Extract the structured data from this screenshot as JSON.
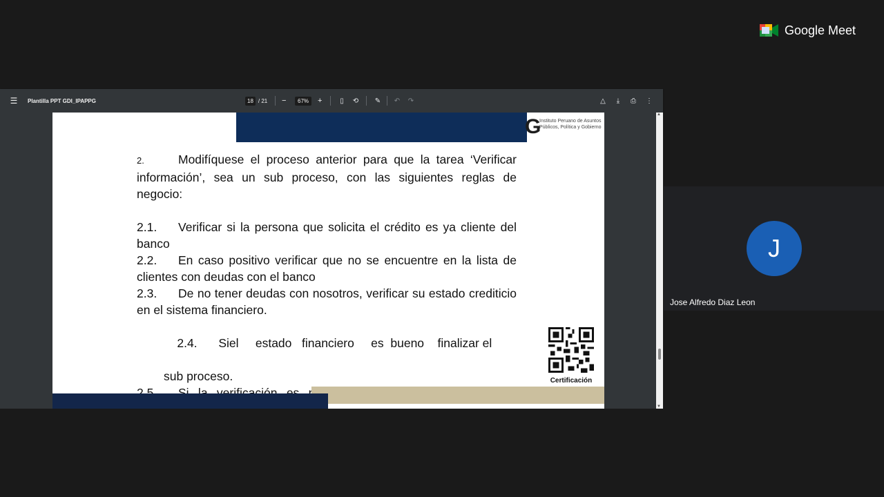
{
  "viewer": {
    "title": "Plantilla PPT GDI_IPAPPG",
    "page_current": "18",
    "page_total": "/ 21",
    "zoom": "67%",
    "icons": [
      "menu-icon",
      "zoom-out-icon",
      "zoom-in-icon",
      "fit-page-icon",
      "rotate-icon",
      "annotate-icon",
      "undo-icon",
      "redo-icon",
      "save-to-drive-icon",
      "download-icon",
      "print-icon",
      "more-icon"
    ]
  },
  "slide": {
    "logo_letter": "G",
    "logo_text": "Instituto Peruano de Asuntos Públicos, Política y Gobierno",
    "intro_num": "2.",
    "intro_text": "Modifíquese el proceso anterior para que la tarea ‘Verificar información’, sea un sub proceso, con las siguientes reglas de negocio:",
    "items": [
      {
        "num": "2.1.",
        "text": "Verificar si la persona que solicita el crédito es ya cliente del banco"
      },
      {
        "num": "2.2.",
        "text": "En caso positivo verificar que no se encuentre en la lista de clientes con deudas con el banco"
      },
      {
        "num": "2.3.",
        "text": "De no tener deudas con nosotros, verificar su estado crediticio en el sistema financiero."
      },
      {
        "num": "2.4.",
        "text": "Siel     estado   financiero     es  bueno    finalizar el",
        "cont": "sub proceso."
      },
      {
        "num": "2.5.",
        "text": "Si la verificación es negativa o su estado crediticio es deficiente rechazar la solicitud comunicándoselo al cliente."
      }
    ],
    "qr_label": "Certificación"
  },
  "meet": {
    "brand": "Google Meet",
    "participant": {
      "initial": "J",
      "name": "Jose Alfredo Diaz Leon",
      "avatar_color": "#1a5fb4"
    }
  }
}
